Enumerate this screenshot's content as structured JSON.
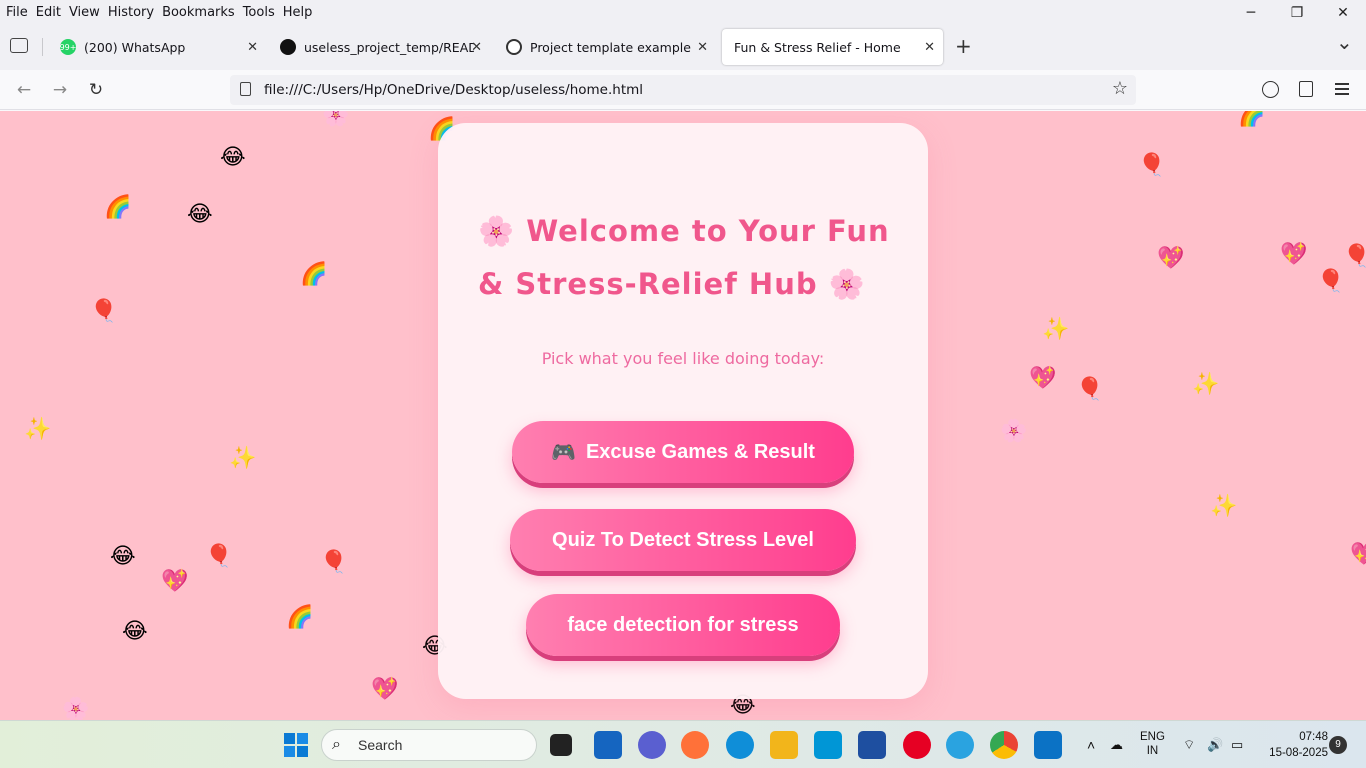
{
  "menu": [
    "File",
    "Edit",
    "View",
    "History",
    "Bookmarks",
    "Tools",
    "Help"
  ],
  "window_controls": {
    "minimize": "─",
    "restore": "❐",
    "close": "✕"
  },
  "tabs": [
    {
      "title": "(200) WhatsApp",
      "favicon": "whatsapp-icon",
      "badge": "99+",
      "close": "✕"
    },
    {
      "title": "useless_project_temp/README.md",
      "favicon": "github-icon",
      "close": "✕"
    },
    {
      "title": "Project template example",
      "favicon": "openai-icon",
      "close": "✕"
    },
    {
      "title": "Fun & Stress Relief - Home",
      "close": "✕"
    }
  ],
  "new_tab": "+",
  "tab_list": "⌄",
  "nav": {
    "back": "←",
    "forward": "→",
    "reload": "↻",
    "bookmark": "☆"
  },
  "url": "file:///C:/Users/Hp/OneDrive/Desktop/useless/home.html",
  "page": {
    "title_line1": "🌸 Welcome to Your Fun",
    "title_line2": "& Stress-Relief Hub 🌸",
    "subtitle": "Pick what you feel like doing today:",
    "buttons": [
      {
        "icon": "🎮",
        "label": "Excuse Games & Result"
      },
      {
        "label": "Quiz To Detect Stress Level"
      },
      {
        "label": "face detection for stress"
      }
    ]
  },
  "floating_emojis": [
    "🌈",
    "😂",
    "🎈",
    "✨",
    "💖",
    "🌸"
  ],
  "taskbar": {
    "search_placeholder": "Search",
    "lang_line1": "ENG",
    "lang_line2": "IN",
    "time": "07:48",
    "date": "15-08-2025",
    "notifications": "9"
  },
  "colors": {
    "background": "#ffc0cb",
    "accent": "#f0578c",
    "button_start": "#ff7fb0",
    "button_end": "#ff3d8e"
  }
}
